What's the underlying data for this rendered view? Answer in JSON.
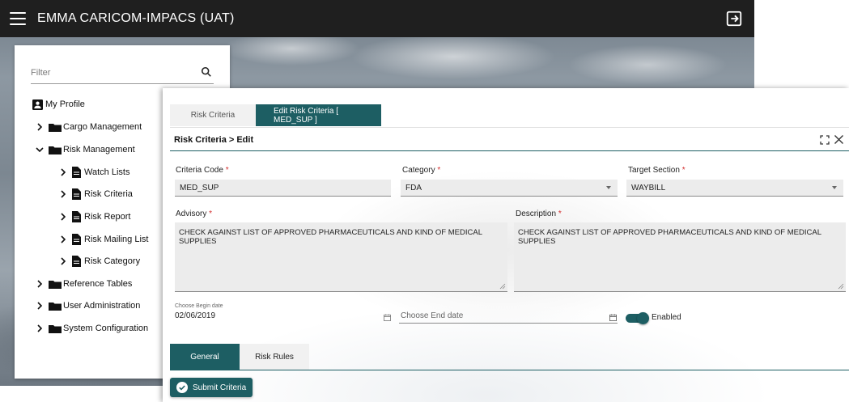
{
  "app": {
    "title": "EMMA CARICOM-IMPACS (UAT)"
  },
  "sidebar": {
    "filter_placeholder": "Filter",
    "items": [
      {
        "label": "My Profile"
      },
      {
        "label": "Cargo Management"
      },
      {
        "label": "Risk Management"
      },
      {
        "label": "Watch Lists"
      },
      {
        "label": "Risk Criteria"
      },
      {
        "label": "Risk Report"
      },
      {
        "label": "Risk Mailing List"
      },
      {
        "label": "Risk Category"
      },
      {
        "label": "Reference Tables"
      },
      {
        "label": "User Administration"
      },
      {
        "label": "System Configuration"
      }
    ]
  },
  "tabs": [
    {
      "label": "Risk Criteria",
      "active": false
    },
    {
      "label": "Edit Risk Criteria [ MED_SUP ]",
      "active": true
    }
  ],
  "header": {
    "breadcrumb": "Risk Criteria > Edit"
  },
  "form": {
    "criteria_code": {
      "label": "Criteria Code",
      "required": "*",
      "value": "MED_SUP"
    },
    "category": {
      "label": "Category",
      "required": "*",
      "value": "FDA"
    },
    "target_section": {
      "label": "Target Section",
      "required": "*",
      "value": "WAYBILL"
    },
    "advisory": {
      "label": "Advisory",
      "required": "*",
      "value": "CHECK AGAINST LIST OF APPROVED PHARMACEUTICALS AND KIND OF MEDICAL SUPPLIES"
    },
    "description": {
      "label": "Description",
      "required": "*",
      "value": "CHECK AGAINST LIST OF APPROVED PHARMACEUTICALS AND KIND OF MEDICAL SUPPLIES"
    },
    "begin_date": {
      "label": "Choose Begin date",
      "value": "02/06/2019"
    },
    "end_date": {
      "placeholder": "Choose End date"
    },
    "enabled": {
      "label": "Enabled",
      "on": true
    }
  },
  "subtabs": [
    {
      "label": "General",
      "active": true
    },
    {
      "label": "Risk Rules",
      "active": false
    }
  ],
  "actions": {
    "submit_label": "Submit Criteria"
  },
  "colors": {
    "accent": "#1d5e63",
    "topbar": "#1f1f1f",
    "required": "#d32f2f"
  }
}
